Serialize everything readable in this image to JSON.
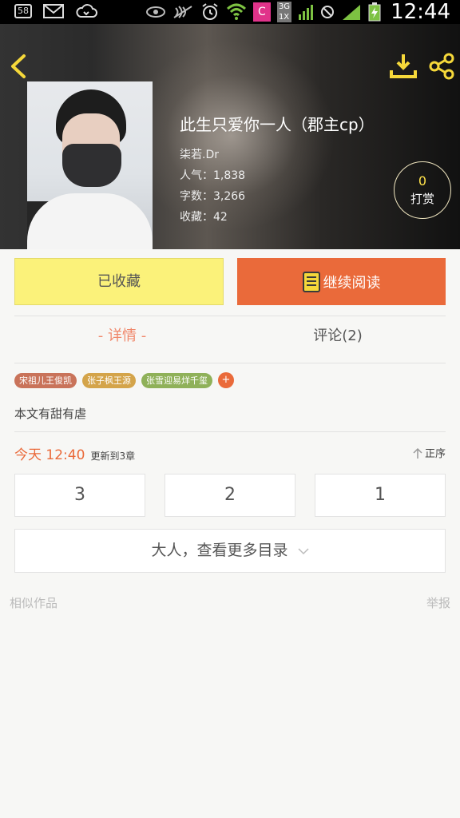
{
  "status_bar": {
    "notification_count": "58",
    "network_badge_top": "3G",
    "network_badge_bottom": "1X",
    "app_badge": "C",
    "time": "12:44"
  },
  "book": {
    "title": "此生只爱你一人（郡主cp）",
    "author": "柒若.Dr",
    "popularity": "人气：1,838",
    "word_count": "字数：3,266",
    "favorites": "收藏：42"
  },
  "reward": {
    "count": "0",
    "label": "打赏"
  },
  "actions": {
    "collected_label": "已收藏",
    "continue_label": "继续阅读"
  },
  "tabs": {
    "detail": "- 详情 -",
    "comments": "评论(2)"
  },
  "tags": [
    {
      "label": "宋祖儿王俊凯",
      "color": "#c9735a"
    },
    {
      "label": "张子枫王源",
      "color": "#d4a44a"
    },
    {
      "label": "张雪迎易烊千玺",
      "color": "#8fb159"
    }
  ],
  "tag_add": "+",
  "description": "本文有甜有虐",
  "update": {
    "time": "今天 12:40",
    "text": "更新到3章",
    "sort_label": "正序"
  },
  "chapters": [
    "3",
    "2",
    "1"
  ],
  "more_catalog": "大人，查看更多目录",
  "footer": {
    "similar": "相似作品",
    "report": "举报"
  },
  "colors": {
    "accent": "#ea6a3a",
    "collected_bg": "#fbf27a",
    "tab_active": "#f0876a",
    "icon_yellow": "#f5d83a"
  }
}
